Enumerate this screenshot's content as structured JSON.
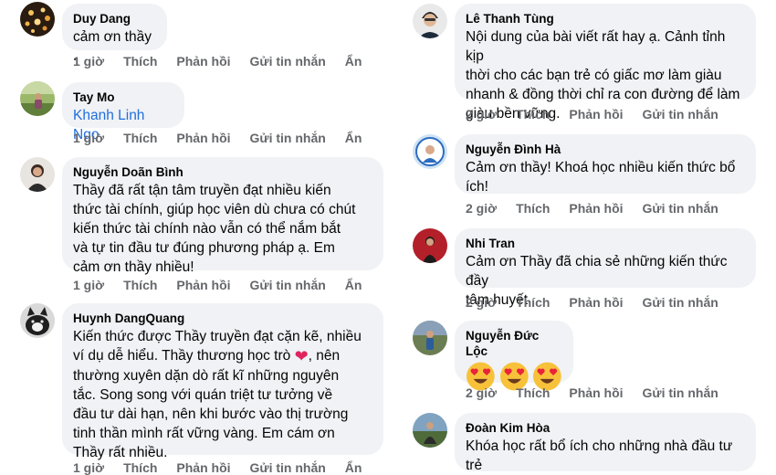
{
  "actions": {
    "like": "Thích",
    "reply": "Phản hồi",
    "message": "Gửi tin nhắn",
    "hide": "Ẩn"
  },
  "comments_left": [
    {
      "author": "Duy Dang",
      "text": "cảm ơn  thầy .",
      "time": "1 giờ"
    },
    {
      "author": "Tay Mo",
      "text": "Khanh Linh Ngo",
      "time": "1 giờ"
    },
    {
      "author": "Nguyễn Doãn Bình",
      "lines": [
        "Thầy đã rất tận tâm truyền đạt nhiều kiến",
        "thức tài chính, giúp học viên dù chưa có chút",
        "kiến thức tài chính nào vẫn có thể nắm bắt",
        "và tự tin đầu tư đúng phương pháp ạ. Em",
        "cảm ơn thầy nhiều!"
      ],
      "time": "1 giờ"
    },
    {
      "author": "Huynh DangQuang",
      "lines": [
        "Kiến thức được Thầy truyền đạt cặn kẽ, nhiều",
        "ví dụ dễ hiểu. Thầy thương học trò",
        ", nên",
        "thường xuyên dặn dò rất kĩ những nguyên",
        "tắc. Song song với quán triệt tư tưởng về",
        "đầu tư dài hạn, nên khi bước vào thị trường",
        "tinh thần mình rất vững vàng. Em cám ơn",
        "Thầy rất nhiều."
      ],
      "heart_emoji": "heart",
      "time": "1 giờ"
    }
  ],
  "comments_right": [
    {
      "author": "Lê Thanh Tùng",
      "lines": [
        "Nội dung của bài viết rất hay ạ. Cảnh tỉnh kịp",
        "thời cho các bạn trẻ có giấc mơ làm giàu",
        "nhanh & đồng thời chỉ ra con đường để làm",
        "giàu bền vững."
      ],
      "time": "2 giờ"
    },
    {
      "author": "Nguyễn Đình Hà",
      "lines": [
        "Cảm ơn thầy! Khoá học nhiều kiến thức bổ",
        "ích!"
      ],
      "time": "2 giờ"
    },
    {
      "author": "Nhi Tran",
      "lines": [
        "Cảm ơn Thầy đã chia sẻ những kiến thức đầy",
        "tâm huyết."
      ],
      "time": "2 giờ"
    },
    {
      "author": "Nguyễn Đức Lộc",
      "emoji": "heart-eyes-emoji",
      "emoji_count": 3,
      "time": "2 giờ"
    },
    {
      "author": "Đoàn Kim Hòa",
      "lines": [
        "Khóa học rất bổ ích cho những nhà đầu tư",
        "trẻ"
      ]
    }
  ]
}
